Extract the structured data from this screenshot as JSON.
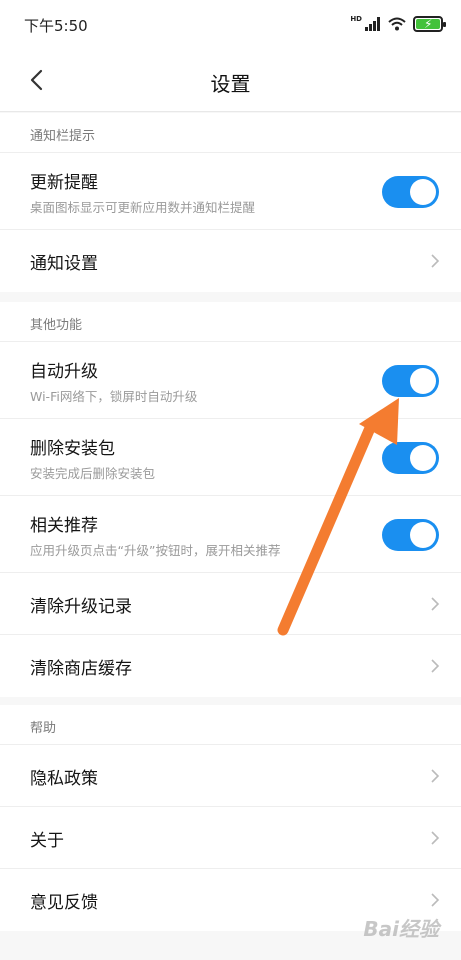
{
  "status": {
    "time": "下午5:50",
    "hd": "HD"
  },
  "nav": {
    "title": "设置"
  },
  "sections": [
    {
      "title": "通知栏提示",
      "rows": [
        {
          "title": "更新提醒",
          "subtitle": "桌面图标显示可更新应用数并通知栏提醒",
          "control": "toggle",
          "on": true
        },
        {
          "title": "通知设置",
          "control": "chevron"
        }
      ]
    },
    {
      "title": "其他功能",
      "rows": [
        {
          "title": "自动升级",
          "subtitle": "Wi-Fi网络下，锁屏时自动升级",
          "control": "toggle",
          "on": true
        },
        {
          "title": "删除安装包",
          "subtitle": "安装完成后删除安装包",
          "control": "toggle",
          "on": true
        },
        {
          "title": "相关推荐",
          "subtitle": "应用升级页点击“升级”按钮时，展开相关推荐",
          "control": "toggle",
          "on": true
        },
        {
          "title": "清除升级记录",
          "control": "chevron"
        },
        {
          "title": "清除商店缓存",
          "control": "chevron"
        }
      ]
    },
    {
      "title": "帮助",
      "rows": [
        {
          "title": "隐私政策",
          "control": "chevron"
        },
        {
          "title": "关于",
          "control": "chevron"
        },
        {
          "title": "意见反馈",
          "control": "chevron"
        }
      ]
    }
  ],
  "watermark": "Bai经验",
  "colors": {
    "toggle_on": "#1a8ff0",
    "annotation_arrow": "#f47c30",
    "battery": "#43c23a"
  }
}
